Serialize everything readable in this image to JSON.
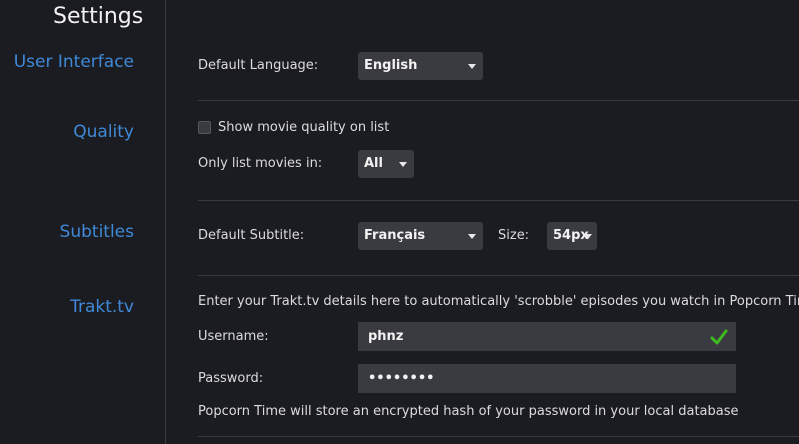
{
  "page_title": "Settings",
  "sections": {
    "user_interface": {
      "label": "User Interface",
      "default_language_label": "Default Language:",
      "default_language_value": "English"
    },
    "quality": {
      "label": "Quality",
      "show_quality_label": "Show movie quality on list",
      "show_quality_checked": false,
      "only_list_label": "Only list movies in:",
      "only_list_value": "All"
    },
    "subtitles": {
      "label": "Subtitles",
      "default_subtitle_label": "Default Subtitle:",
      "default_subtitle_value": "Français",
      "size_label": "Size:",
      "size_value": "54px"
    },
    "trakt": {
      "label": "Trakt.tv",
      "intro_text": "Enter your Trakt.tv details here to automatically 'scrobble' episodes you watch in Popcorn Time",
      "username_label": "Username:",
      "username_value": "phnz",
      "password_label": "Password:",
      "password_value": "••••••••",
      "note_text": "Popcorn Time will store an encrypted hash of your password in your local database"
    }
  },
  "colors": {
    "background": "#1b1c21",
    "accent": "#3f89d8",
    "control_bg": "#3a3b41",
    "valid_check": "#3dbb1e"
  },
  "icons": {
    "dropdown_caret": "chevron-down-icon",
    "username_valid": "check-icon"
  }
}
